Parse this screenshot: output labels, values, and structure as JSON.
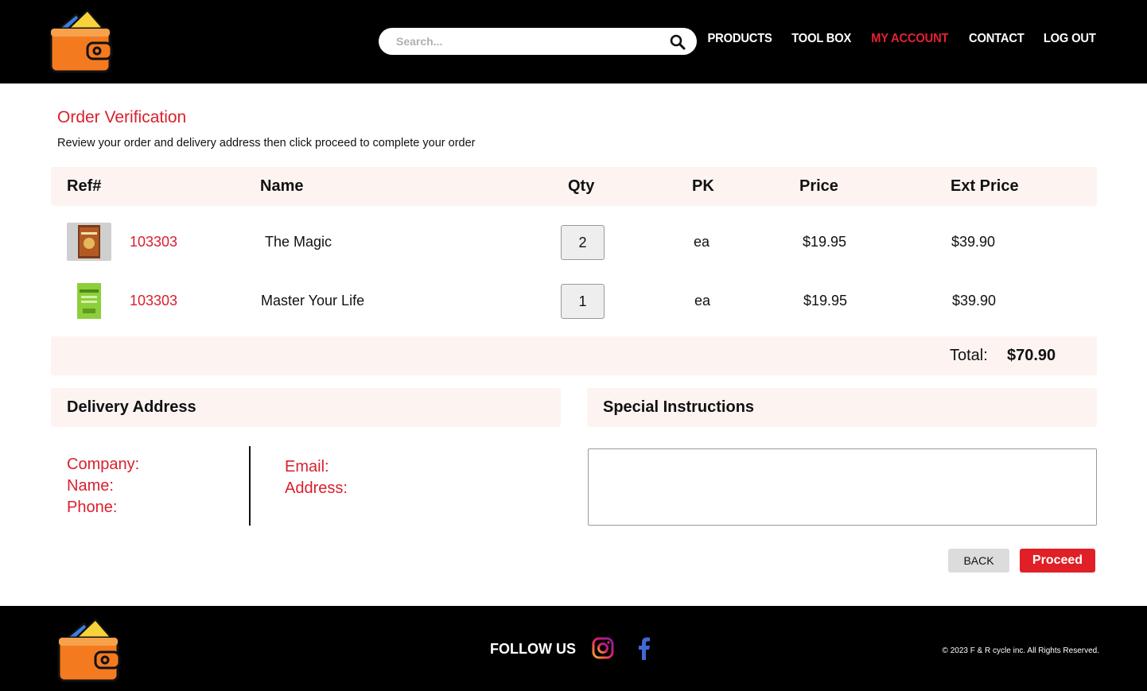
{
  "header": {
    "search_placeholder": "Search...",
    "nav": [
      "PRODUCTS",
      "TOOL BOX",
      "MY ACCOUNT",
      "CONTACT",
      "LOG OUT"
    ],
    "active_nav": "MY ACCOUNT"
  },
  "page": {
    "title": "Order Verification",
    "subtitle": "Review your order and delivery address then click proceed to complete your order"
  },
  "table": {
    "columns": [
      "Ref#",
      "Name",
      "Qty",
      "PK",
      "Price",
      "Ext Price"
    ],
    "rows": [
      {
        "ref": "103303",
        "name": "The Magic",
        "qty": "2",
        "pk": "ea",
        "price": "$19.95",
        "ext_price": "$39.90"
      },
      {
        "ref": "103303",
        "name": "Master Your Life",
        "qty": "1",
        "pk": "ea",
        "price": "$19.95",
        "ext_price": "$39.90"
      }
    ],
    "total_label": "Total:",
    "total_value": "$70.90"
  },
  "delivery": {
    "heading": "Delivery Address",
    "company_label": "Company:",
    "name_label": "Name:",
    "phone_label": "Phone:",
    "email_label": "Email:",
    "address_label": "Address:"
  },
  "instructions": {
    "heading": "Special Instructions",
    "value": ""
  },
  "actions": {
    "back_label": "BACK",
    "proceed_label": "Proceed"
  },
  "footer": {
    "follow_label": "FOLLOW US",
    "copyright": "© 2023 F & R cycle inc. All Rights Reserved."
  },
  "colors": {
    "accent": "#d9202e",
    "header_bg": "#000000",
    "row_highlight": "#fdf4f2",
    "proceed_bg": "#e01f26"
  },
  "icons": [
    "wallet-logo-icon",
    "search-icon",
    "instagram-icon",
    "facebook-icon"
  ]
}
